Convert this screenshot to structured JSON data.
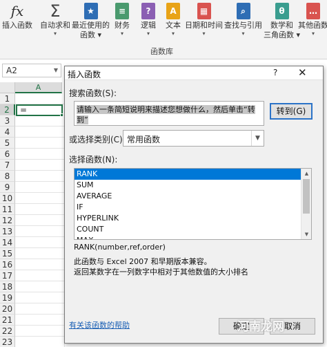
{
  "ribbon": {
    "insert_function_glyph": "fx",
    "buttons": [
      {
        "label": "插入函数",
        "icon": "fx-icon"
      },
      {
        "label": "自动求和",
        "icon": "sigma-icon",
        "dropdown": true
      },
      {
        "label": "最近使用的",
        "label2": "函数",
        "icon": "star-book-icon",
        "dropdown": true
      },
      {
        "label": "财务",
        "icon": "finance-book-icon",
        "dropdown": true
      },
      {
        "label": "逻辑",
        "icon": "question-book-icon",
        "dropdown": true
      },
      {
        "label": "文本",
        "icon": "text-book-icon",
        "dropdown": true
      },
      {
        "label": "日期和时间",
        "icon": "calendar-book-icon",
        "dropdown": true
      },
      {
        "label": "查找与引用",
        "icon": "magnifier-book-icon",
        "dropdown": true
      },
      {
        "label": "数学和",
        "label2": "三角函数",
        "icon": "theta-book-icon",
        "dropdown": true
      },
      {
        "label": "其他函数",
        "icon": "more-book-icon",
        "dropdown": true
      }
    ],
    "group_label": "函数库",
    "glyphs": {
      "sigma": "Σ",
      "logic": "?",
      "text": "A",
      "theta": "θ"
    },
    "colors": {
      "star": "#2e6db4",
      "finance": "#4a9a6e",
      "logic": "#8b5fb3",
      "text": "#e8a317",
      "date": "#d9534f",
      "lookup": "#2e6db4",
      "math": "#3a9d8f",
      "more": "#d9534f"
    }
  },
  "namebox": {
    "value": "A2"
  },
  "sheet": {
    "column_header": "A",
    "rows": [
      "1",
      "2",
      "3",
      "4",
      "5",
      "6",
      "7",
      "8",
      "9",
      "10",
      "11",
      "12",
      "13",
      "14",
      "15",
      "16",
      "17",
      "18",
      "19",
      "20",
      "21",
      "22",
      "23"
    ],
    "active_cell_value": "="
  },
  "dialog": {
    "title": "插入函数",
    "help_glyph": "?",
    "close_glyph": "✕",
    "search_label": "搜索函数(S):",
    "search_value": "请输入一条简短说明来描述您想做什么，然后单击“转到”",
    "go_button": "转到(G)",
    "category_label": "或选择类别(C):",
    "category_value": "常用函数",
    "function_label": "选择函数(N):",
    "functions": [
      "RANK",
      "SUM",
      "AVERAGE",
      "IF",
      "HYPERLINK",
      "COUNT",
      "MAX"
    ],
    "selected_function": "RANK",
    "syntax": "RANK(number,ref,order)",
    "description_line1": "此函数与 Excel 2007 和早期版本兼容。",
    "description_line2": "返回某数字在一列数字中相对于其他数值的大小排名",
    "help_link": "有关该函数的帮助",
    "ok_button": "确定",
    "cancel_button": "取消",
    "watermark": "河南龙网"
  }
}
